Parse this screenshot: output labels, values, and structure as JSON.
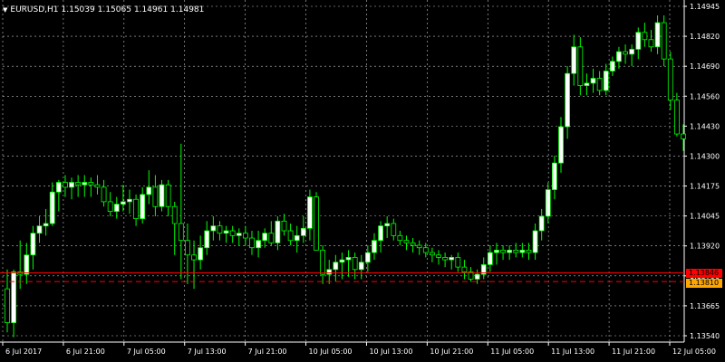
{
  "header": {
    "symbol": "EURUSD,H1",
    "open": "1.15039",
    "high": "1.15065",
    "low": "1.14961",
    "close": "1.14981",
    "menu_icon": "triangle-down-icon"
  },
  "colors": {
    "background": "#000000",
    "grid": "#c0c0c0",
    "bull_candle": "#ffffff",
    "bear_candle": "#000000",
    "candle_outline": "#00ff00",
    "bid_line": "#ff0000",
    "ask_line": "#ff0000",
    "bid_tag": "#ff0000",
    "ask_tag": "#ffa500",
    "axis_text": "#ffffff"
  },
  "price_tags": {
    "bid": "1.13846",
    "ask": "1.13810"
  },
  "chart_data": {
    "type": "candlestick",
    "ylim": [
      1.1356,
      1.14955
    ],
    "price_ticks": [
      "1.14945",
      "1.14820",
      "1.14690",
      "1.14560",
      "1.14430",
      "1.14300",
      "1.14175",
      "1.14045",
      "1.13920",
      "1.13790",
      "1.13665",
      "1.13540"
    ],
    "time_ticks": [
      "6 Jul 2017",
      "6 Jul 21:00",
      "7 Jul 05:00",
      "7 Jul 13:00",
      "7 Jul 21:00",
      "10 Jul 05:00",
      "10 Jul 13:00",
      "10 Jul 21:00",
      "11 Jul 05:00",
      "11 Jul 13:00",
      "11 Jul 21:00",
      "12 Jul 05:00"
    ],
    "bid": 1.13846,
    "ask": 1.1381,
    "candles": [
      [
        1.1378,
        1.1386,
        1.136,
        1.1364
      ],
      [
        1.1364,
        1.1386,
        1.1358,
        1.1385
      ],
      [
        1.1385,
        1.1398,
        1.1378,
        1.1384
      ],
      [
        1.1384,
        1.1397,
        1.138,
        1.1392
      ],
      [
        1.1392,
        1.1404,
        1.1386,
        1.1401
      ],
      [
        1.1401,
        1.1408,
        1.1397,
        1.1404
      ],
      [
        1.1404,
        1.1411,
        1.14,
        1.1405
      ],
      [
        1.1405,
        1.1422,
        1.1404,
        1.1418
      ],
      [
        1.1418,
        1.1423,
        1.141,
        1.1422
      ],
      [
        1.1422,
        1.1425,
        1.1416,
        1.142
      ],
      [
        1.142,
        1.1424,
        1.1415,
        1.1422
      ],
      [
        1.1422,
        1.1425,
        1.1416,
        1.1421
      ],
      [
        1.1421,
        1.1425,
        1.1416,
        1.1422
      ],
      [
        1.1422,
        1.1424,
        1.1416,
        1.1421
      ],
      [
        1.1421,
        1.1425,
        1.1417,
        1.142
      ],
      [
        1.142,
        1.1423,
        1.1412,
        1.1414
      ],
      [
        1.1414,
        1.1418,
        1.1408,
        1.141
      ],
      [
        1.141,
        1.1416,
        1.1407,
        1.1413
      ],
      [
        1.1413,
        1.1421,
        1.141,
        1.1414
      ],
      [
        1.1414,
        1.1419,
        1.1409,
        1.1415
      ],
      [
        1.1415,
        1.1417,
        1.1404,
        1.1407
      ],
      [
        1.1407,
        1.142,
        1.1405,
        1.1417
      ],
      [
        1.1417,
        1.1427,
        1.1413,
        1.142
      ],
      [
        1.142,
        1.1425,
        1.1408,
        1.1412
      ],
      [
        1.1412,
        1.1423,
        1.141,
        1.1421
      ],
      [
        1.1421,
        1.1423,
        1.1408,
        1.1412
      ],
      [
        1.1412,
        1.1414,
        1.1392,
        1.1405
      ],
      [
        1.1405,
        1.1438,
        1.1382,
        1.1398
      ],
      [
        1.1398,
        1.1405,
        1.138,
        1.1392
      ],
      [
        1.1392,
        1.1398,
        1.1378,
        1.139
      ],
      [
        1.139,
        1.14,
        1.1386,
        1.1395
      ],
      [
        1.1395,
        1.1406,
        1.1392,
        1.1402
      ],
      [
        1.1402,
        1.1408,
        1.1398,
        1.1404
      ],
      [
        1.1404,
        1.1406,
        1.1398,
        1.1401
      ],
      [
        1.1401,
        1.1404,
        1.1397,
        1.1402
      ],
      [
        1.1402,
        1.1404,
        1.1397,
        1.14
      ],
      [
        1.14,
        1.1403,
        1.1396,
        1.1401
      ],
      [
        1.1401,
        1.1404,
        1.1396,
        1.1399
      ],
      [
        1.1399,
        1.1402,
        1.1392,
        1.1395
      ],
      [
        1.1395,
        1.1402,
        1.1391,
        1.1398
      ],
      [
        1.1398,
        1.1403,
        1.1395,
        1.1401
      ],
      [
        1.1401,
        1.1406,
        1.1396,
        1.1397
      ],
      [
        1.1397,
        1.1408,
        1.1394,
        1.1406
      ],
      [
        1.1406,
        1.1409,
        1.14,
        1.1402
      ],
      [
        1.1402,
        1.1405,
        1.1396,
        1.1398
      ],
      [
        1.1398,
        1.1404,
        1.1393,
        1.14
      ],
      [
        1.14,
        1.1408,
        1.1397,
        1.1403
      ],
      [
        1.1403,
        1.1419,
        1.1398,
        1.1416
      ],
      [
        1.1416,
        1.1418,
        1.14,
        1.1394
      ],
      [
        1.1394,
        1.1396,
        1.138,
        1.1384
      ],
      [
        1.1384,
        1.139,
        1.138,
        1.1386
      ],
      [
        1.1386,
        1.1392,
        1.1381,
        1.1389
      ],
      [
        1.1389,
        1.1393,
        1.1382,
        1.139
      ],
      [
        1.139,
        1.1394,
        1.1383,
        1.1391
      ],
      [
        1.1391,
        1.1393,
        1.1382,
        1.1386
      ],
      [
        1.1386,
        1.1392,
        1.1382,
        1.1389
      ],
      [
        1.1389,
        1.1396,
        1.1385,
        1.1393
      ],
      [
        1.1393,
        1.1401,
        1.139,
        1.1398
      ],
      [
        1.1398,
        1.1406,
        1.1393,
        1.1404
      ],
      [
        1.1404,
        1.1408,
        1.1399,
        1.1405
      ],
      [
        1.1405,
        1.1407,
        1.1398,
        1.14
      ],
      [
        1.14,
        1.1402,
        1.1396,
        1.1398
      ],
      [
        1.1398,
        1.14,
        1.1394,
        1.1397
      ],
      [
        1.1397,
        1.1399,
        1.1393,
        1.1396
      ],
      [
        1.1396,
        1.1398,
        1.1392,
        1.1395
      ],
      [
        1.1395,
        1.1397,
        1.1391,
        1.1393
      ],
      [
        1.1393,
        1.1395,
        1.1389,
        1.1392
      ],
      [
        1.1392,
        1.1394,
        1.1388,
        1.1391
      ],
      [
        1.1391,
        1.1393,
        1.1387,
        1.139
      ],
      [
        1.139,
        1.1392,
        1.1386,
        1.1391
      ],
      [
        1.1391,
        1.1393,
        1.1385,
        1.1387
      ],
      [
        1.1387,
        1.139,
        1.1382,
        1.1385
      ],
      [
        1.1385,
        1.1387,
        1.1381,
        1.1382
      ],
      [
        1.1382,
        1.1386,
        1.138,
        1.1384
      ],
      [
        1.1384,
        1.1391,
        1.1382,
        1.1388
      ],
      [
        1.1388,
        1.1396,
        1.1385,
        1.1393
      ],
      [
        1.1393,
        1.1397,
        1.1388,
        1.1394
      ],
      [
        1.1394,
        1.1396,
        1.139,
        1.1393
      ],
      [
        1.1393,
        1.1396,
        1.139,
        1.1394
      ],
      [
        1.1394,
        1.1397,
        1.1391,
        1.1393
      ],
      [
        1.1393,
        1.1397,
        1.1391,
        1.1394
      ],
      [
        1.1394,
        1.1397,
        1.139,
        1.1393
      ],
      [
        1.1393,
        1.1405,
        1.139,
        1.1402
      ],
      [
        1.1402,
        1.1411,
        1.1398,
        1.1408
      ],
      [
        1.1408,
        1.1422,
        1.1405,
        1.1419
      ],
      [
        1.1419,
        1.1433,
        1.1415,
        1.143
      ],
      [
        1.143,
        1.1449,
        1.1426,
        1.1445
      ],
      [
        1.1445,
        1.147,
        1.144,
        1.1467
      ],
      [
        1.1467,
        1.1483,
        1.1462,
        1.1478
      ],
      [
        1.1478,
        1.1482,
        1.1458,
        1.1462
      ],
      [
        1.1462,
        1.1467,
        1.1458,
        1.1463
      ],
      [
        1.1463,
        1.1469,
        1.1459,
        1.1465
      ],
      [
        1.1465,
        1.1468,
        1.1458,
        1.146
      ],
      [
        1.146,
        1.1471,
        1.1458,
        1.1468
      ],
      [
        1.1468,
        1.1474,
        1.1466,
        1.1472
      ],
      [
        1.1472,
        1.1478,
        1.1469,
        1.1476
      ],
      [
        1.1476,
        1.1479,
        1.1471,
        1.1475
      ],
      [
        1.1475,
        1.1479,
        1.147,
        1.1477
      ],
      [
        1.1477,
        1.1486,
        1.1473,
        1.1484
      ],
      [
        1.1484,
        1.1488,
        1.1478,
        1.1481
      ],
      [
        1.1481,
        1.1485,
        1.1476,
        1.1478
      ],
      [
        1.1478,
        1.1491,
        1.1475,
        1.1488
      ],
      [
        1.1488,
        1.1491,
        1.147,
        1.1473
      ],
      [
        1.1473,
        1.1476,
        1.1452,
        1.1456
      ],
      [
        1.1456,
        1.1459,
        1.1441,
        1.1442
      ],
      [
        1.1442,
        1.1446,
        1.1435,
        1.144
      ]
    ]
  }
}
